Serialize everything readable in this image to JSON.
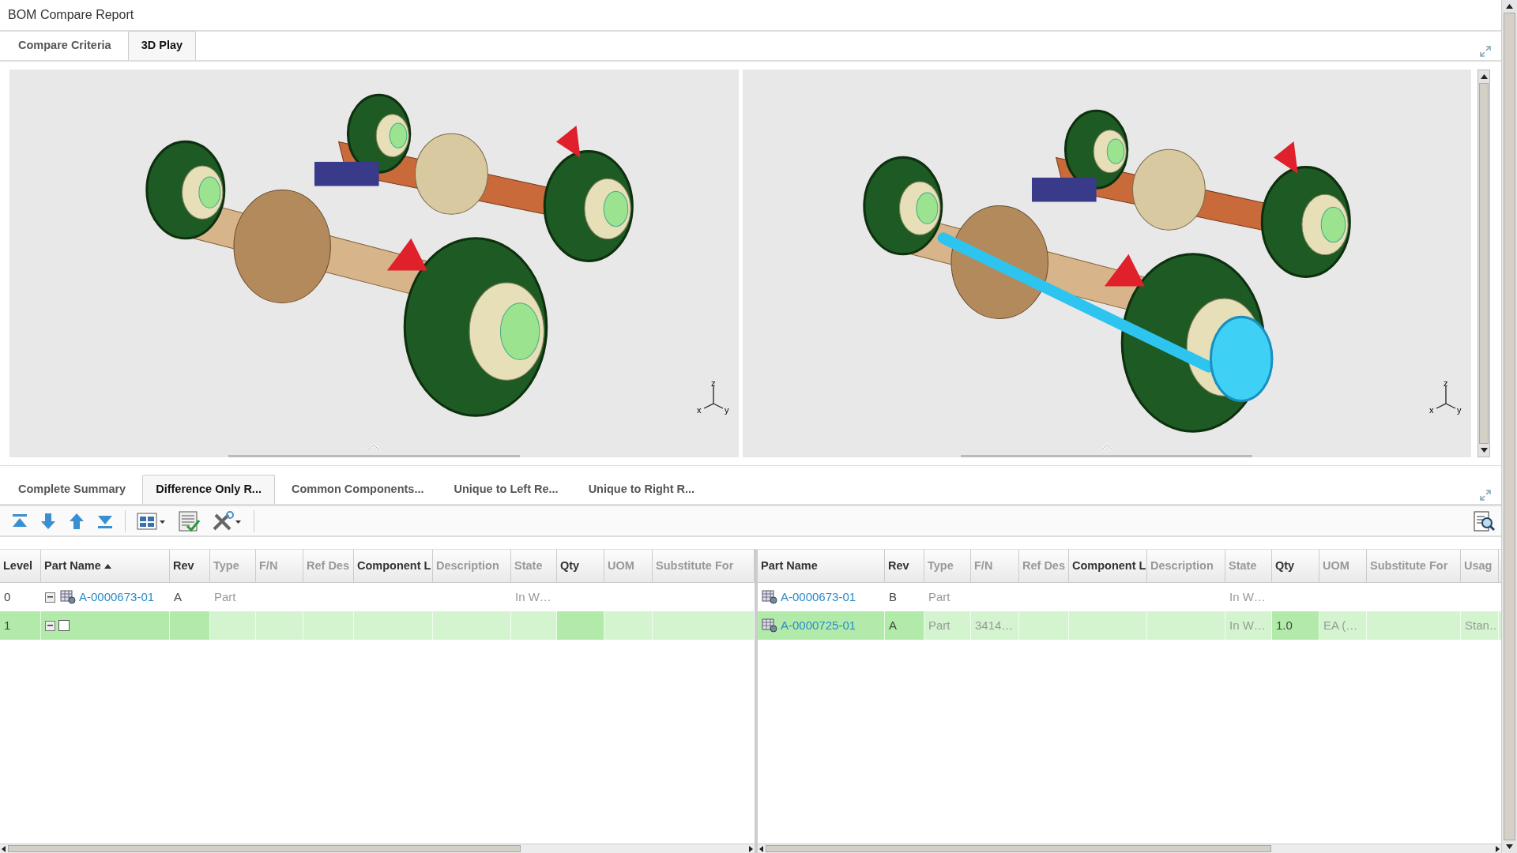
{
  "window": {
    "title": "BOM Compare Report"
  },
  "top_tabs": [
    {
      "label": "Compare Criteria",
      "selected": false
    },
    {
      "label": "3D Play",
      "selected": true
    }
  ],
  "viewers": [
    {
      "axis_labels": [
        "z",
        "x",
        "y"
      ],
      "highlighted_part": false
    },
    {
      "axis_labels": [
        "z",
        "x",
        "y"
      ],
      "highlighted_part": true
    }
  ],
  "bottom_tabs": [
    {
      "label": "Complete Summary",
      "selected": false
    },
    {
      "label": "Difference Only R...",
      "selected": true
    },
    {
      "label": "Common Components...",
      "selected": false
    },
    {
      "label": "Unique to Left Re...",
      "selected": false
    },
    {
      "label": "Unique to Right R...",
      "selected": false
    }
  ],
  "left_table": {
    "columns": [
      {
        "label": "Level",
        "emphasis": true
      },
      {
        "label": "Part Name",
        "emphasis": true,
        "sorted": true
      },
      {
        "label": "Rev",
        "emphasis": true
      },
      {
        "label": "Type",
        "emphasis": false
      },
      {
        "label": "F/N",
        "emphasis": false
      },
      {
        "label": "Ref Des",
        "emphasis": false
      },
      {
        "label": "Component L",
        "emphasis": true
      },
      {
        "label": "Description",
        "emphasis": false
      },
      {
        "label": "State",
        "emphasis": false
      },
      {
        "label": "Qty",
        "emphasis": true
      },
      {
        "label": "UOM",
        "emphasis": false
      },
      {
        "label": "Substitute For",
        "emphasis": false
      }
    ],
    "rows": [
      {
        "highlighted": false,
        "cells": [
          {
            "kind": "text",
            "text": "0",
            "changed": false
          },
          {
            "kind": "part",
            "text": "A-0000673-01",
            "expanded": true,
            "icon": true,
            "changed": false
          },
          {
            "kind": "text",
            "text": "A",
            "changed": false
          },
          {
            "kind": "text",
            "text": "Part",
            "changed": false
          },
          {
            "kind": "text",
            "changed": false
          },
          {
            "kind": "text",
            "changed": false
          },
          {
            "kind": "text",
            "changed": false
          },
          {
            "kind": "text",
            "changed": false
          },
          {
            "kind": "text",
            "text": "In W…",
            "changed": false
          },
          {
            "kind": "text",
            "changed": false
          },
          {
            "kind": "text",
            "changed": false
          },
          {
            "kind": "text",
            "changed": false
          }
        ]
      },
      {
        "highlighted": true,
        "cells": [
          {
            "kind": "text",
            "text": "1",
            "changed": true
          },
          {
            "kind": "part",
            "expanded": true,
            "icon": false,
            "empty_box": true,
            "changed": true
          },
          {
            "kind": "text",
            "changed": true
          },
          {
            "kind": "text",
            "changed": false
          },
          {
            "kind": "text",
            "changed": false
          },
          {
            "kind": "text",
            "changed": false
          },
          {
            "kind": "text",
            "changed": false
          },
          {
            "kind": "text",
            "changed": false
          },
          {
            "kind": "text",
            "changed": false
          },
          {
            "kind": "text",
            "changed": true
          },
          {
            "kind": "text",
            "changed": false
          },
          {
            "kind": "text",
            "changed": false
          }
        ]
      }
    ]
  },
  "right_table": {
    "columns": [
      {
        "label": "Part Name",
        "emphasis": true
      },
      {
        "label": "Rev",
        "emphasis": true
      },
      {
        "label": "Type",
        "emphasis": false
      },
      {
        "label": "F/N",
        "emphasis": false
      },
      {
        "label": "Ref Des",
        "emphasis": false
      },
      {
        "label": "Component L",
        "emphasis": true
      },
      {
        "label": "Description",
        "emphasis": false
      },
      {
        "label": "State",
        "emphasis": false
      },
      {
        "label": "Qty",
        "emphasis": true
      },
      {
        "label": "UOM",
        "emphasis": false
      },
      {
        "label": "Substitute For",
        "emphasis": false
      },
      {
        "label": "Usag",
        "emphasis": false
      }
    ],
    "rows": [
      {
        "highlighted": false,
        "cells": [
          {
            "kind": "part",
            "text": "A-0000673-01",
            "icon": true,
            "changed": false
          },
          {
            "kind": "text",
            "text": "B",
            "changed": false
          },
          {
            "kind": "text",
            "text": "Part",
            "changed": false
          },
          {
            "kind": "text",
            "changed": false
          },
          {
            "kind": "text",
            "changed": false
          },
          {
            "kind": "text",
            "changed": false
          },
          {
            "kind": "text",
            "changed": false
          },
          {
            "kind": "text",
            "text": "In W…",
            "changed": false
          },
          {
            "kind": "text",
            "changed": false
          },
          {
            "kind": "text",
            "changed": false
          },
          {
            "kind": "text",
            "changed": false
          },
          {
            "kind": "text",
            "changed": false
          }
        ]
      },
      {
        "highlighted": true,
        "cells": [
          {
            "kind": "part",
            "text": "A-0000725-01",
            "icon": true,
            "changed": true
          },
          {
            "kind": "text",
            "text": "A",
            "changed": true
          },
          {
            "kind": "text",
            "text": "Part",
            "changed": false
          },
          {
            "kind": "text",
            "text": "3414…",
            "changed": false
          },
          {
            "kind": "text",
            "changed": false
          },
          {
            "kind": "text",
            "changed": false
          },
          {
            "kind": "text",
            "changed": false
          },
          {
            "kind": "text",
            "text": "In W…",
            "changed": false
          },
          {
            "kind": "text",
            "text": "1.0",
            "changed": true
          },
          {
            "kind": "text",
            "text": "EA (…",
            "changed": false
          },
          {
            "kind": "text",
            "changed": false
          },
          {
            "kind": "text",
            "text": "Stan…",
            "changed": false
          }
        ]
      }
    ]
  }
}
